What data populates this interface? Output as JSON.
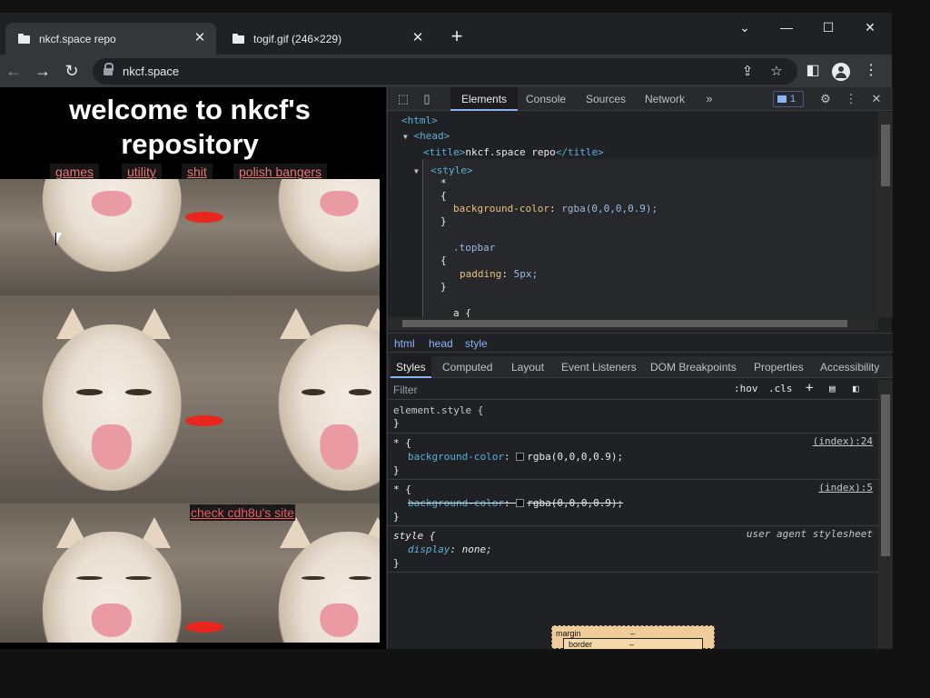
{
  "browser": {
    "tabs": [
      {
        "title": "nkcf.space repo",
        "active": true
      },
      {
        "title": "togif.gif (246×229)",
        "active": false
      }
    ],
    "url": "nkcf.space"
  },
  "page": {
    "heading": "welcome to nkcf's repository",
    "nav": [
      "games",
      "utility",
      "shit",
      "polish bangers"
    ],
    "footer_link": "check cdh8u's site"
  },
  "devtools": {
    "tabs": [
      "Elements",
      "Console",
      "Sources",
      "Network"
    ],
    "issues_count": "1",
    "dom": {
      "html": "<html>",
      "head": "<head>",
      "title_open": "<title>",
      "title_text": "nkcf.space repo",
      "title_close": "</title>",
      "style_open": "<style>",
      "css1": "*",
      "brace_open": "{",
      "bg_prop": "background-color",
      "bg_val": "rgba(0,0,0,0.9);",
      "brace_close": "}",
      "topbar": ".topbar",
      "pad_prop": "padding",
      "pad_val": "5px;",
      "a_sel": "a {"
    },
    "breadcrumbs": [
      "html",
      "head",
      "style"
    ],
    "style_tabs": [
      "Styles",
      "Computed",
      "Layout",
      "Event Listeners",
      "DOM Breakpoints",
      "Properties",
      "Accessibility"
    ],
    "filter_placeholder": "Filter",
    "filter_hov": ":hov",
    "filter_cls": ".cls",
    "rules": {
      "element_style": "element.style {",
      "close": "}",
      "star": "* {",
      "src1": "(index):24",
      "src2": "(index):5",
      "prop": "background-color",
      "val": "rgba(0,0,0,0.9);",
      "style_sel": "style {",
      "ua": "user agent stylesheet",
      "display_prop": "display",
      "display_val": "none;"
    },
    "boxmodel": {
      "margin": "margin",
      "border": "border",
      "dash": "–"
    }
  }
}
